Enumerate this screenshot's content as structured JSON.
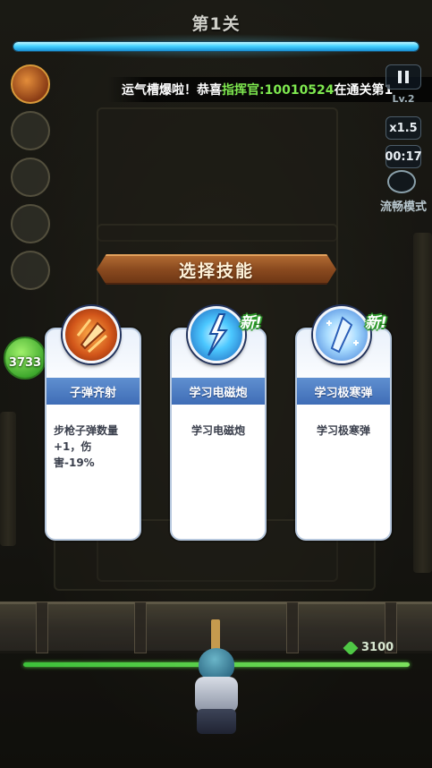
{
  "level": {
    "title": "第1关",
    "progress": 1.0
  },
  "broadcast": {
    "prefix": "运气槽爆啦！恭喜",
    "highlight": "指挥官:10010524",
    "suffix": "在通关第1"
  },
  "hud": {
    "pause_icon": "pause-icon",
    "level_badge": "Lv.2",
    "speed": "x1.5",
    "timer": "00:17",
    "mode_label": "流畅模式"
  },
  "coins": {
    "value": "3733"
  },
  "skill_select": {
    "title": "选择技能",
    "new_label": "新!",
    "cards": [
      {
        "name": "子弹齐射",
        "desc": "步枪子弹数量+1，伤害-19%",
        "icon": "bullet-volley-icon",
        "is_new": false
      },
      {
        "name": "学习电磁炮",
        "desc": "学习电磁炮",
        "icon": "railgun-icon",
        "is_new": true
      },
      {
        "name": "学习极寒弹",
        "desc": "学习极寒弹",
        "icon": "frost-bullet-icon",
        "is_new": true
      }
    ]
  },
  "base": {
    "hp": "3100"
  },
  "colors": {
    "accent": "#47d3ff",
    "new_green": "#2d9a2a",
    "card_band": "#3f6db6",
    "banner": "#8a4a1f"
  }
}
